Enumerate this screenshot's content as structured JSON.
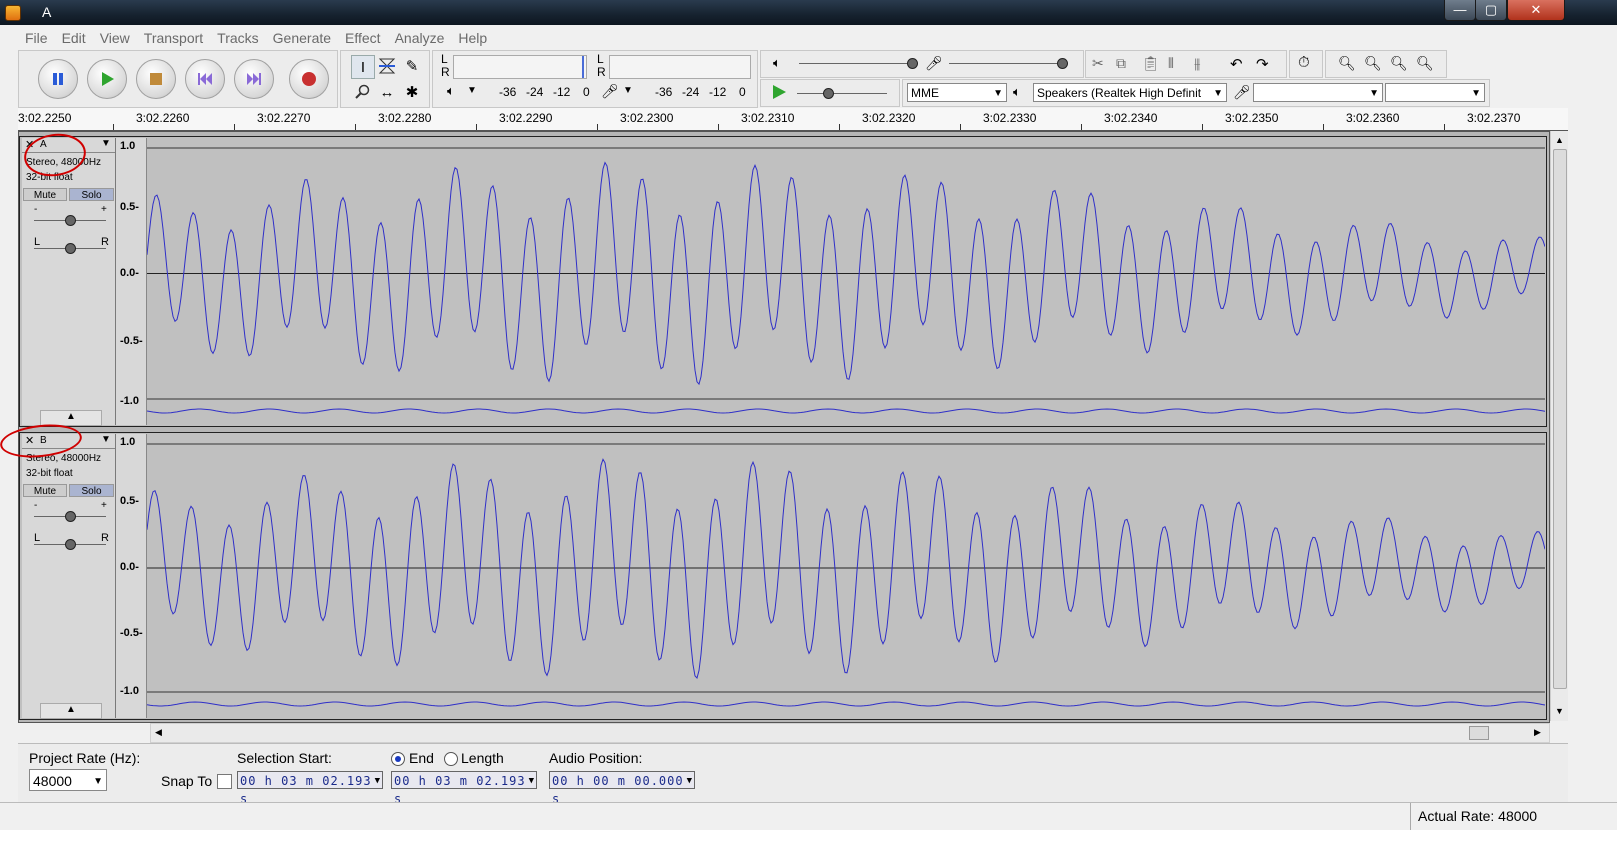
{
  "window": {
    "title": "A",
    "minimize": "—",
    "maximize": "▢",
    "close": "✕"
  },
  "menu": [
    "File",
    "Edit",
    "View",
    "Transport",
    "Tracks",
    "Generate",
    "Effect",
    "Analyze",
    "Help"
  ],
  "meters": {
    "rec_ch_top": "L",
    "rec_ch_bottom": "R",
    "play_ch_top": "L",
    "play_ch_bottom": "R",
    "play_ticks": [
      "-36",
      "-24",
      "-12",
      "0"
    ],
    "rec_ticks": [
      "-36",
      "-24",
      "-12",
      "0"
    ]
  },
  "device": {
    "host": "MME",
    "output": "Speakers (Realtek High Definit",
    "input": "",
    "channels": ""
  },
  "ruler": {
    "labels": [
      "3:02.2250",
      "3:02.2260",
      "3:02.2270",
      "3:02.2280",
      "3:02.2290",
      "3:02.2300",
      "3:02.2310",
      "3:02.2320",
      "3:02.2330",
      "3:02.2340",
      "3:02.2350",
      "3:02.2360",
      "3:02.2370"
    ]
  },
  "scale_labels": [
    "1.0",
    "0.5-",
    "0.0-",
    "-0.5-",
    "-1.0"
  ],
  "tracks": [
    {
      "name": "A",
      "info1": "Stereo, 48000Hz",
      "info2": "32-bit float",
      "mute": "Mute",
      "solo": "Solo",
      "gain_minus": "-",
      "gain_plus": "+",
      "pan_l": "L",
      "pan_r": "R"
    },
    {
      "name": "B",
      "info1": "Stereo, 48000Hz",
      "info2": "32-bit float",
      "mute": "Mute",
      "solo": "Solo",
      "gain_minus": "-",
      "gain_plus": "+",
      "pan_l": "L",
      "pan_r": "R"
    }
  ],
  "bottom": {
    "project_rate_label": "Project Rate (Hz):",
    "project_rate": "48000",
    "snap_to": "Snap To",
    "selection_start_label": "Selection Start:",
    "end_label": "End",
    "length_label": "Length",
    "audio_position_label": "Audio Position:",
    "selection_start": "00 h 03 m 02.193 s",
    "selection_end": "00 h 03 m 02.193 s",
    "audio_position": "00 h 00 m 00.000 s"
  },
  "status": {
    "actual_rate": "Actual Rate: 48000"
  },
  "colors": {
    "waveform": "#2f2fc8",
    "annotation": "#d00000"
  }
}
